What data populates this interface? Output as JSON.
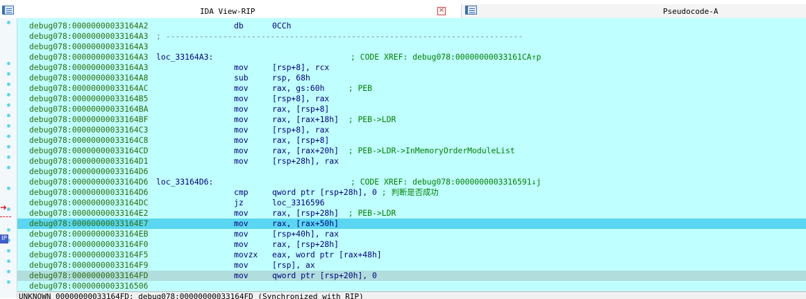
{
  "tabs": [
    {
      "title": "IDA View-RIP"
    },
    {
      "title": "Pseudocode-A"
    }
  ],
  "close_glyph": "✕",
  "gutter": {
    "arrow": "➜",
    "ip_badge": "IP"
  },
  "lines": [
    {
      "addr": "debug078:00000000033164A2",
      "label": "",
      "mnem": "db",
      "ops": "0CCh",
      "comment": ""
    },
    {
      "addr": "debug078:00000000033164A3",
      "separator": "; ---------------------------------------------------------------------------"
    },
    {
      "addr": "debug078:00000000033164A3",
      "label": "",
      "mnem": "",
      "ops": "",
      "comment": ""
    },
    {
      "addr": "debug078:00000000033164A3",
      "label": "loc_33164A3:",
      "mnem": "",
      "ops": "",
      "comment": "; CODE XREF: debug078:00000000033161CA↑p"
    },
    {
      "addr": "debug078:00000000033164A3",
      "label": "",
      "mnem": "mov",
      "ops": "[rsp+8], rcx",
      "comment": ""
    },
    {
      "addr": "debug078:00000000033164A8",
      "label": "",
      "mnem": "sub",
      "ops": "rsp, 68h",
      "comment": ""
    },
    {
      "addr": "debug078:00000000033164AC",
      "label": "",
      "mnem": "mov",
      "ops": "rax, gs:60h     ",
      "comment": "; PEB"
    },
    {
      "addr": "debug078:00000000033164B5",
      "label": "",
      "mnem": "mov",
      "ops": "[rsp+8], rax",
      "comment": ""
    },
    {
      "addr": "debug078:00000000033164BA",
      "label": "",
      "mnem": "mov",
      "ops": "rax, [rsp+8]",
      "comment": ""
    },
    {
      "addr": "debug078:00000000033164BF",
      "label": "",
      "mnem": "mov",
      "ops": "rax, [rax+18h]  ",
      "comment": "; PEB->LDR"
    },
    {
      "addr": "debug078:00000000033164C3",
      "label": "",
      "mnem": "mov",
      "ops": "[rsp+8], rax",
      "comment": ""
    },
    {
      "addr": "debug078:00000000033164C8",
      "label": "",
      "mnem": "mov",
      "ops": "rax, [rsp+8]",
      "comment": ""
    },
    {
      "addr": "debug078:00000000033164CD",
      "label": "",
      "mnem": "mov",
      "ops": "rax, [rax+20h]  ",
      "comment": "; PEB->LDR->InMemoryOrderModuleList"
    },
    {
      "addr": "debug078:00000000033164D1",
      "label": "",
      "mnem": "mov",
      "ops": "[rsp+28h], rax",
      "comment": ""
    },
    {
      "addr": "debug078:00000000033164D6",
      "label": "",
      "mnem": "",
      "ops": "",
      "comment": ""
    },
    {
      "addr": "debug078:00000000033164D6",
      "label": "loc_33164D6:",
      "mnem": "",
      "ops": "",
      "comment": "; CODE XREF: debug078:0000000003316591↓j"
    },
    {
      "addr": "debug078:00000000033164D6",
      "label": "",
      "mnem": "cmp",
      "ops": "qword ptr [rsp+28h], 0 ",
      "comment": "; 判断是否成功"
    },
    {
      "addr": "debug078:00000000033164DC",
      "label": "",
      "mnem": "jz",
      "ops": "loc_3316596",
      "comment": ""
    },
    {
      "addr": "debug078:00000000033164E2",
      "label": "",
      "mnem": "mov",
      "ops": "rax, [rsp+28h]  ",
      "comment": "; PEB->LDR"
    },
    {
      "addr": "debug078:00000000033164E7",
      "label": "",
      "mnem": "mov",
      "ops": "rax, [rax+50h]",
      "comment": "",
      "highlight": "current"
    },
    {
      "addr": "debug078:00000000033164EB",
      "label": "",
      "mnem": "mov",
      "ops": "[rsp+40h], rax",
      "comment": ""
    },
    {
      "addr": "debug078:00000000033164F0",
      "label": "",
      "mnem": "mov",
      "ops": "rax, [rsp+28h]",
      "comment": ""
    },
    {
      "addr": "debug078:00000000033164F5",
      "label": "",
      "mnem": "movzx",
      "ops": "eax, word ptr [rax+48h]",
      "comment": ""
    },
    {
      "addr": "debug078:00000000033164F9",
      "label": "",
      "mnem": "mov",
      "ops": "[rsp], ax",
      "comment": ""
    },
    {
      "addr": "debug078:00000000033164FD",
      "label": "",
      "mnem": "mov",
      "ops": "qword ptr [rsp+20h], 0",
      "comment": "",
      "highlight": "selected"
    },
    {
      "addr": "debug078:0000000003316506",
      "label": "",
      "mnem": "",
      "ops": "",
      "comment": ""
    }
  ],
  "status": "UNKNOWN 00000000033164FD: debug078:00000000033164FD (Synchronized with RIP)",
  "colors": {
    "listing_bg": "#c0ffff",
    "current_line": "#5ad6f0",
    "selected_line": "#b1dddd",
    "address": "#2b6d0a",
    "code": "#000080",
    "comment": "#008000"
  }
}
